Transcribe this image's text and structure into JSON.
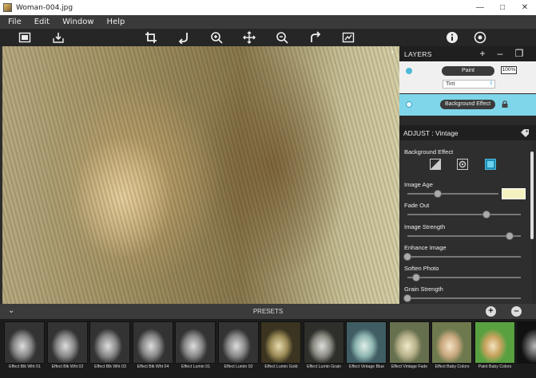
{
  "window": {
    "title": "Woman-004.jpg"
  },
  "menu": [
    "File",
    "Edit",
    "Window",
    "Help"
  ],
  "layers": {
    "title": "LAYERS",
    "layer1": {
      "name": "Paint",
      "opacity": "100%",
      "blend": "Tint"
    },
    "layer2": {
      "name": "Background Effect"
    }
  },
  "adjust": {
    "title": "ADJUST : Vintage",
    "background_effect_label": "Background Effect",
    "sliders": [
      {
        "label": "Image Age",
        "value": 0.33
      },
      {
        "label": "Fade Out",
        "value": 0.7
      },
      {
        "label": "Image Strength",
        "value": 0.9
      },
      {
        "label": "Enhance Image",
        "value": 0.0
      },
      {
        "label": "Soften Photo",
        "value": 0.08
      },
      {
        "label": "Grain Strength",
        "value": 0.0
      }
    ],
    "swatch_color": "#f5f2c2"
  },
  "presets": {
    "title": "PRESETS",
    "items": [
      {
        "name": "Effect Blk Wht 01",
        "tint": "bw"
      },
      {
        "name": "Effect Blk Wht 02",
        "tint": "bw"
      },
      {
        "name": "Effect Blk Wht 03",
        "tint": "bw"
      },
      {
        "name": "Effect Blk Wht 04",
        "tint": "bw"
      },
      {
        "name": "Effect Lumin 01",
        "tint": "bw"
      },
      {
        "name": "Effect Lumin 02",
        "tint": "bw"
      },
      {
        "name": "Effect Lumin Gold",
        "tint": "gold"
      },
      {
        "name": "Effect Lumin Grain",
        "tint": "grain"
      },
      {
        "name": "Effect Vintage Blue",
        "tint": "blue"
      },
      {
        "name": "Effect Vintage Fade",
        "tint": "fade"
      },
      {
        "name": "Effect Baby Colors",
        "tint": "baby"
      },
      {
        "name": "Paint Baby Colors",
        "tint": "paint"
      },
      {
        "name": "",
        "tint": "dark"
      }
    ]
  },
  "colors": {
    "accent": "#4fb7d8",
    "selected_layer": "#7fd6ea"
  }
}
